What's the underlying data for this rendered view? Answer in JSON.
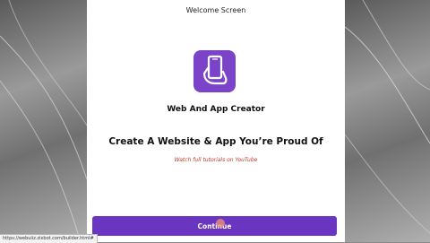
{
  "welcome_screen": {
    "title": "Welcome Screen",
    "app_name": "Web And App Creator",
    "headline": "Create A Website & App You’re Proud Of",
    "subtext": "Watch full tutorials on YouTube",
    "continue_label": "Continue",
    "logo_icon": "phone-in-hand-icon",
    "accent_color": "#6a35c0"
  },
  "status_bar": {
    "url": "https://webuiiz.zixbot.com/builder.html#"
  }
}
